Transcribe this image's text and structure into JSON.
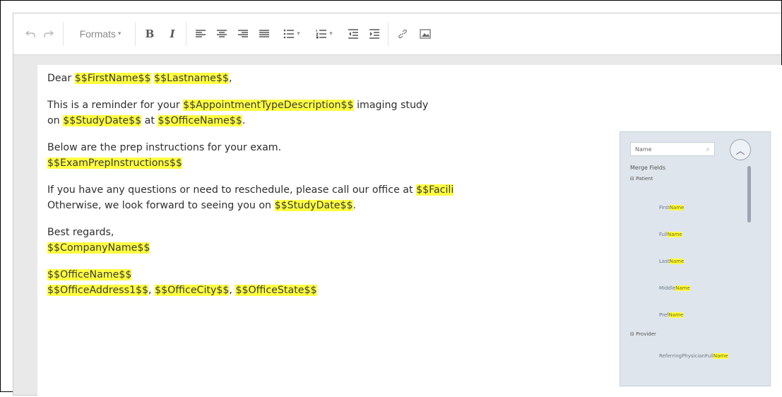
{
  "toolbar": {
    "undo_icon": "undo-icon",
    "redo_icon": "redo-icon",
    "formats_label": "Formats",
    "bold_label": "B",
    "italic_label": "I"
  },
  "document": {
    "greeting_prefix": "Dear ",
    "first_name": "$$FirstName$$",
    "last_name": "$$Lastname$$",
    "comma": ",",
    "line2a": "This is a reminder for your ",
    "appt_type": "$$AppointmentTypeDescription$$",
    "line2b": " imaging study",
    "line3a": "on ",
    "study_date": "$$StudyDate$$",
    "line3b": " at ",
    "office_name": "$$OfficeName$$",
    "line3c": ".",
    "prep_line": "Below are the prep instructions for your exam.",
    "exam_prep": "$$ExamPrepInstructions$$",
    "questions_line": "If you have any questions or need to reschedule, please call our office at ",
    "facility_phone": "$$Facili",
    "otherwise_a": "Otherwise, we look forward to seeing you on ",
    "study_date2": "$$StudyDate$$",
    "otherwise_b": ".",
    "regards": "Best regards,",
    "company_name": "$$CompanyName$$",
    "office_name2": "$$OfficeName$$",
    "office_address": "$$OfficeAddress1$$",
    "sep1": ", ",
    "office_city": "$$OfficeCity$$",
    "sep2": ", ",
    "office_state": "$$OfficeState$$"
  },
  "merge_panel": {
    "search_value": "Name",
    "title": "Merge Fields",
    "group1": "Patient",
    "items": [
      {
        "prefix": "First",
        "hl": "Name"
      },
      {
        "prefix": "Full",
        "hl": "Name"
      },
      {
        "prefix": "Last",
        "hl": "Name"
      },
      {
        "prefix": "Middle",
        "hl": "Name"
      },
      {
        "prefix": "Pref",
        "hl": "Name"
      }
    ],
    "group2": "Provider",
    "item6": {
      "prefix": "ReferringPhysicianFull",
      "hl": "Name"
    }
  }
}
